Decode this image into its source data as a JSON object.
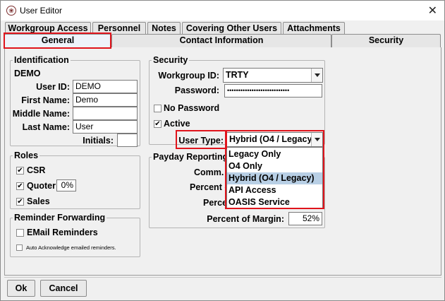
{
  "window": {
    "title": "User Editor",
    "close_glyph": "✕",
    "icon": "app-logo-icon"
  },
  "tabs_row1": [
    "Workgroup Access",
    "Personnel",
    "Notes",
    "Covering Other Users",
    "Attachments"
  ],
  "tabs_row2": [
    "General",
    "Contact Information",
    "Security"
  ],
  "selected_tab": "General",
  "identification": {
    "title": "Identification",
    "name": "DEMO",
    "user_id_label": "User ID:",
    "user_id_value": "DEMO",
    "first_name_label": "First Name:",
    "first_name_value": "Demo",
    "middle_name_label": "Middle Name:",
    "middle_name_value": "",
    "last_name_label": "Last Name:",
    "last_name_value": "User",
    "initials_label": "Initials:",
    "initials_value": ""
  },
  "roles": {
    "title": "Roles",
    "csr_label": "CSR",
    "csr_checked": true,
    "quoter_label": "Quoter",
    "quoter_checked": true,
    "quoter_percent": "0%",
    "sales_label": "Sales",
    "sales_checked": true
  },
  "reminder": {
    "title": "Reminder Forwarding",
    "email_label": "EMail Reminders",
    "email_checked": false,
    "auto_ack_label": "Auto Acknowledge emailed reminders.",
    "auto_ack_checked": false
  },
  "security": {
    "title": "Security",
    "workgroup_label": "Workgroup ID:",
    "workgroup_value": "TRTY",
    "password_label": "Password:",
    "password_value": "••••••••••••••••••••••••••••",
    "no_password_label": "No Password",
    "no_password_checked": false,
    "active_label": "Active",
    "active_checked": true,
    "user_type_label": "User Type:",
    "user_type_value": "Hybrid (O4 / Legacy)",
    "user_type_options": [
      "Legacy Only",
      "O4 Only",
      "Hybrid (O4 / Legacy)",
      "API Access",
      "OASIS Service"
    ],
    "user_type_selected_index": 2
  },
  "payday": {
    "title": "Payday Reporting",
    "comm_label": "Comm. A",
    "percent_c_label": "Percent o",
    "percent_label": "Perce",
    "margin_label": "Percent of Margin:",
    "margin_value": "52%"
  },
  "buttons": {
    "ok": "Ok",
    "cancel": "Cancel"
  },
  "colors": {
    "highlight_outline": "#e0141c",
    "selected_option": "#b8cfe5"
  }
}
